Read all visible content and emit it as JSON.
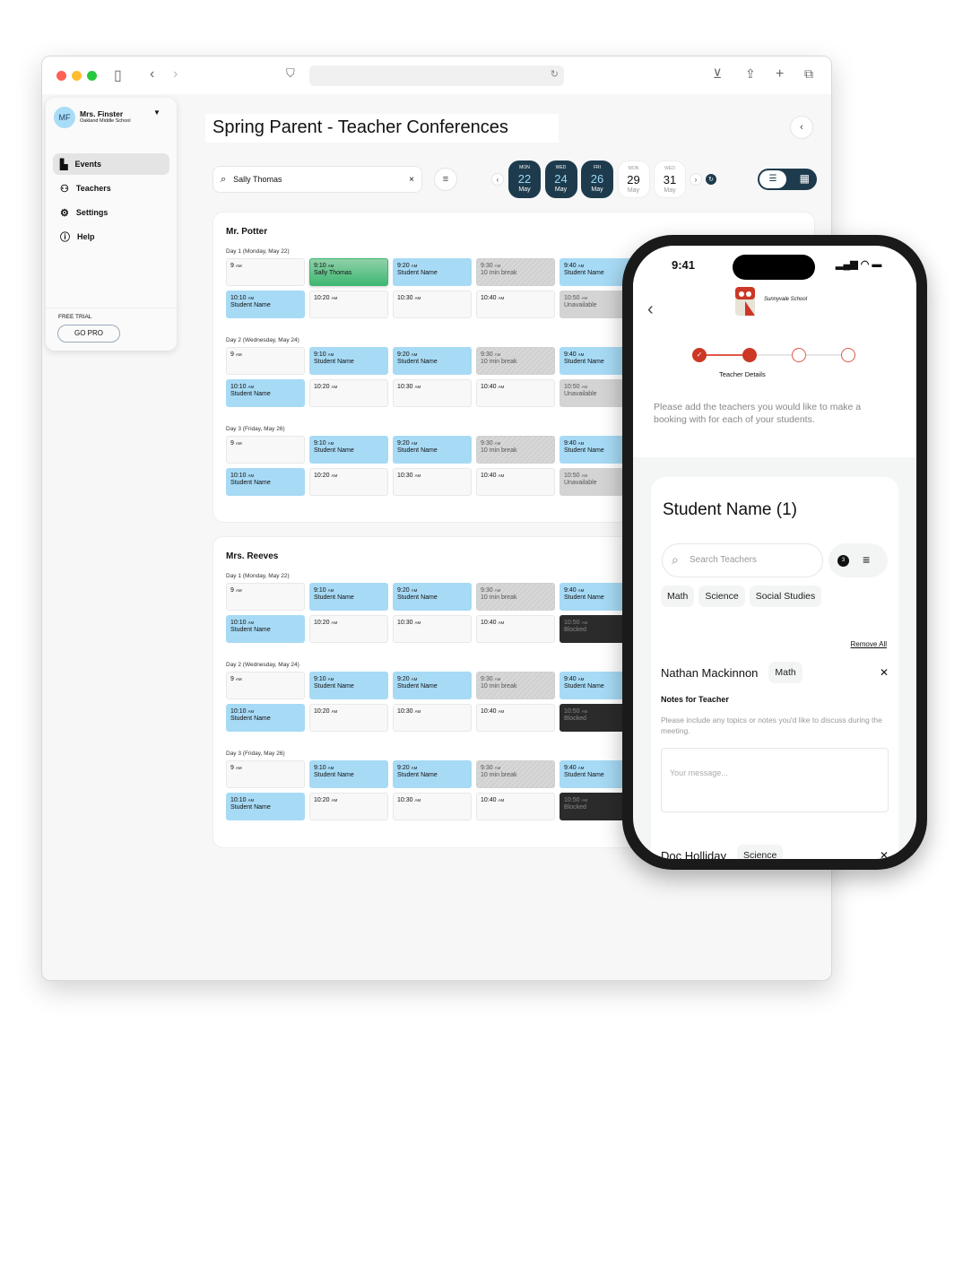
{
  "colors": {
    "navy": "#1d3b4d",
    "booked": "#a7daf5",
    "selected": "#3fb872",
    "accent": "#cc3726"
  },
  "sidebar": {
    "avatar": "MF",
    "user": "Mrs. Finster",
    "school": "Oakland Middle School",
    "items": [
      {
        "label": "Events",
        "icon": "dashboard-icon"
      },
      {
        "label": "Teachers",
        "icon": "person-icon"
      },
      {
        "label": "Settings",
        "icon": "gear-icon"
      },
      {
        "label": "Help",
        "icon": "help-icon"
      }
    ],
    "trial": "FREE TRIAL",
    "cta": "GO PRO"
  },
  "header": {
    "title": "Spring Parent - Teacher Conferences"
  },
  "search": {
    "value": "Sally Thomas"
  },
  "dates": [
    {
      "dow": "MON",
      "day": "22",
      "month": "May",
      "selected": true
    },
    {
      "dow": "WED",
      "day": "24",
      "month": "May",
      "selected": true
    },
    {
      "dow": "FRI",
      "day": "26",
      "month": "May",
      "selected": true
    },
    {
      "dow": "MON",
      "day": "29",
      "month": "May",
      "selected": false
    },
    {
      "dow": "WED",
      "day": "31",
      "month": "May",
      "selected": false
    }
  ],
  "teachers": [
    {
      "name": "Mr. Potter",
      "days": [
        {
          "label": "Day 1 (Monday, May 22)",
          "slots": [
            [
              "9",
              "AM",
              "",
              "empty"
            ],
            [
              "9:10",
              "AM",
              "Sally Thomas",
              "selected"
            ],
            [
              "9:20",
              "AM",
              "Student Name",
              "booked"
            ],
            [
              "9:30",
              "AM",
              "10 min break",
              "break"
            ],
            [
              "9:40",
              "AM",
              "Student Name",
              "booked"
            ],
            [
              "10:10",
              "AM",
              "Student Name",
              "booked"
            ],
            [
              "10:20",
              "AM",
              "",
              "empty"
            ],
            [
              "10:30",
              "AM",
              "",
              "empty"
            ],
            [
              "10:40",
              "AM",
              "",
              "empty"
            ],
            [
              "10:50",
              "AM",
              "Unavailable",
              "unavailable"
            ]
          ]
        },
        {
          "label": "Day 2 (Wednesday, May 24)",
          "slots": [
            [
              "9",
              "AM",
              "",
              "empty"
            ],
            [
              "9:10",
              "AM",
              "Student Name",
              "booked"
            ],
            [
              "9:20",
              "AM",
              "Student Name",
              "booked"
            ],
            [
              "9:30",
              "AM",
              "10 min break",
              "break"
            ],
            [
              "9:40",
              "AM",
              "Student Name",
              "booked"
            ],
            [
              "10:10",
              "AM",
              "Student Name",
              "booked"
            ],
            [
              "10:20",
              "AM",
              "",
              "empty"
            ],
            [
              "10:30",
              "AM",
              "",
              "empty"
            ],
            [
              "10:40",
              "AM",
              "",
              "empty"
            ],
            [
              "10:50",
              "AM",
              "Unavailable",
              "unavailable"
            ]
          ]
        },
        {
          "label": "Day 3 (Friday, May 26)",
          "slots": [
            [
              "9",
              "AM",
              "",
              "empty"
            ],
            [
              "9:10",
              "AM",
              "Student Name",
              "booked"
            ],
            [
              "9:20",
              "AM",
              "Student Name",
              "booked"
            ],
            [
              "9:30",
              "AM",
              "10 min break",
              "break"
            ],
            [
              "9:40",
              "AM",
              "Student Name",
              "booked"
            ],
            [
              "10:10",
              "AM",
              "Student Name",
              "booked"
            ],
            [
              "10:20",
              "AM",
              "",
              "empty"
            ],
            [
              "10:30",
              "AM",
              "",
              "empty"
            ],
            [
              "10:40",
              "AM",
              "",
              "empty"
            ],
            [
              "10:50",
              "AM",
              "Unavailable",
              "unavailable"
            ]
          ]
        }
      ]
    },
    {
      "name": "Mrs. Reeves",
      "days": [
        {
          "label": "Day 1 (Monday, May 22)",
          "slots": [
            [
              "9",
              "AM",
              "",
              "empty"
            ],
            [
              "9:10",
              "AM",
              "Student Name",
              "booked"
            ],
            [
              "9:20",
              "AM",
              "Student Name",
              "booked"
            ],
            [
              "9:30",
              "AM",
              "10 min break",
              "break"
            ],
            [
              "9:40",
              "AM",
              "Student Name",
              "booked"
            ],
            [
              "10:10",
              "AM",
              "Student Name",
              "booked"
            ],
            [
              "10:20",
              "AM",
              "",
              "empty"
            ],
            [
              "10:30",
              "AM",
              "",
              "empty"
            ],
            [
              "10:40",
              "AM",
              "",
              "empty"
            ],
            [
              "10:50",
              "AM",
              "Blocked",
              "blocked"
            ]
          ]
        },
        {
          "label": "Day 2 (Wednesday, May 24)",
          "slots": [
            [
              "9",
              "AM",
              "",
              "empty"
            ],
            [
              "9:10",
              "AM",
              "Student Name",
              "booked"
            ],
            [
              "9:20",
              "AM",
              "Student Name",
              "booked"
            ],
            [
              "9:30",
              "AM",
              "10 min break",
              "break"
            ],
            [
              "9:40",
              "AM",
              "Student Name",
              "booked"
            ],
            [
              "10:10",
              "AM",
              "Student Name",
              "booked"
            ],
            [
              "10:20",
              "AM",
              "",
              "empty"
            ],
            [
              "10:30",
              "AM",
              "",
              "empty"
            ],
            [
              "10:40",
              "AM",
              "",
              "empty"
            ],
            [
              "10:50",
              "AM",
              "Blocked",
              "blocked"
            ]
          ]
        },
        {
          "label": "Day 3 (Friday, May 26)",
          "slots": [
            [
              "9",
              "AM",
              "",
              "empty"
            ],
            [
              "9:10",
              "AM",
              "Student Name",
              "booked"
            ],
            [
              "9:20",
              "AM",
              "Student Name",
              "booked"
            ],
            [
              "9:30",
              "AM",
              "10 min break",
              "break"
            ],
            [
              "9:40",
              "AM",
              "Student Name",
              "booked"
            ],
            [
              "10:10",
              "AM",
              "Student Name",
              "booked"
            ],
            [
              "10:20",
              "AM",
              "",
              "empty"
            ],
            [
              "10:30",
              "AM",
              "",
              "empty"
            ],
            [
              "10:40",
              "AM",
              "",
              "empty"
            ],
            [
              "10:50",
              "AM",
              "Blocked",
              "blocked"
            ]
          ]
        }
      ]
    }
  ],
  "phone": {
    "time": "9:41",
    "school": "Sunnyvale School",
    "step_label": "Teacher Details",
    "steps_done": 1,
    "step_current": 2,
    "steps_total": 4,
    "intro": "Please add the teachers you would like to make a booking with for each of your students.",
    "student": "Student Name (1)",
    "search_placeholder": "Search Teachers",
    "filter_count": "3",
    "subjects": [
      "Math",
      "Science",
      "Social Studies"
    ],
    "remove_all": "Remove All",
    "teacher1": {
      "name": "Nathan Mackinnon",
      "subject": "Math"
    },
    "notes_title": "Notes for Teacher",
    "notes_hint": "Please include any topics or notes you'd like to discuss during the meeting.",
    "message_placeholder": "Your message...",
    "teacher2": {
      "name": "Doc Holliday",
      "subject": "Science"
    }
  }
}
